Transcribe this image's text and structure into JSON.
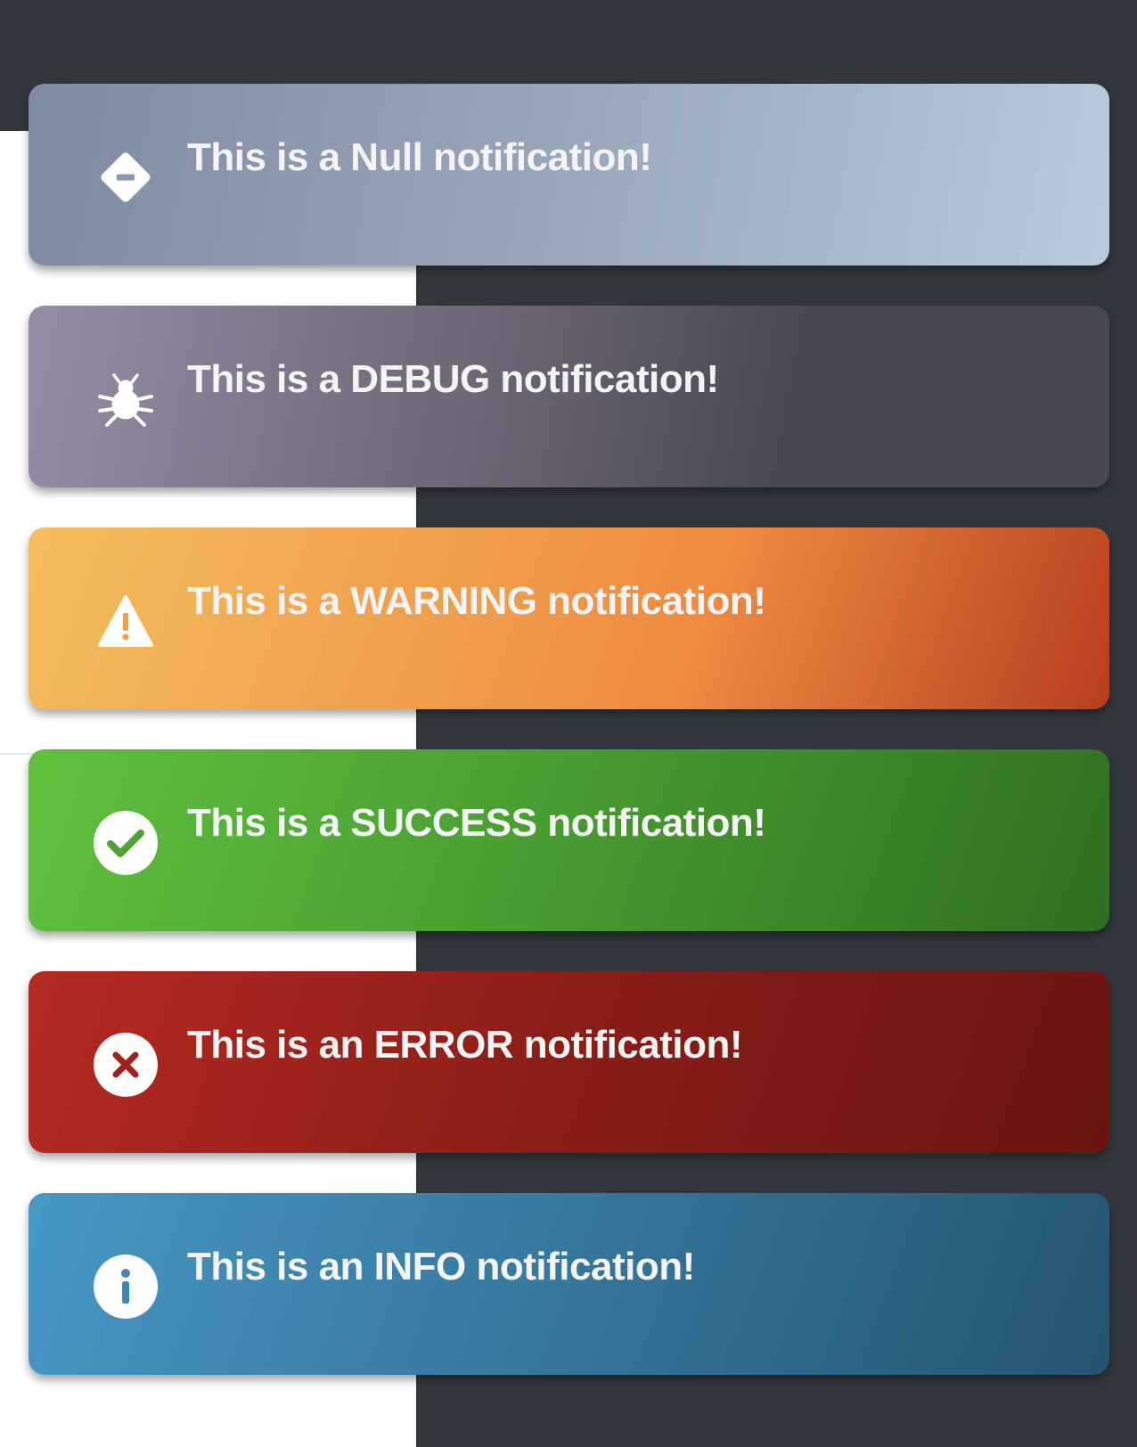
{
  "notifications": [
    {
      "id": "null",
      "message": "This is a Null notification!",
      "icon": "diamond-minus-icon"
    },
    {
      "id": "debug",
      "message": "This is a DEBUG notification!",
      "icon": "bug-icon"
    },
    {
      "id": "warning",
      "message": "This is a WARNING notification!",
      "icon": "warning-triangle-icon"
    },
    {
      "id": "success",
      "message": "This is a SUCCESS notification!",
      "icon": "check-circle-icon"
    },
    {
      "id": "error",
      "message": "This is an ERROR notification!",
      "icon": "x-circle-icon"
    },
    {
      "id": "info",
      "message": "This is an INFO notification!",
      "icon": "info-circle-icon"
    }
  ],
  "colors": {
    "background_dark": "#33373d",
    "background_light": "#ffffff",
    "null_start": "#7f8aa3",
    "null_end": "#b8cadc",
    "debug_start": "#958da6",
    "debug_end": "#4b4855",
    "warning_start": "#f4bd5d",
    "warning_end": "#b73f20",
    "success_start": "#60c13e",
    "success_end": "#306f21",
    "error_start": "#b62a22",
    "error_end": "#6a1511",
    "info_start": "#4798c6",
    "info_end": "#255470"
  }
}
